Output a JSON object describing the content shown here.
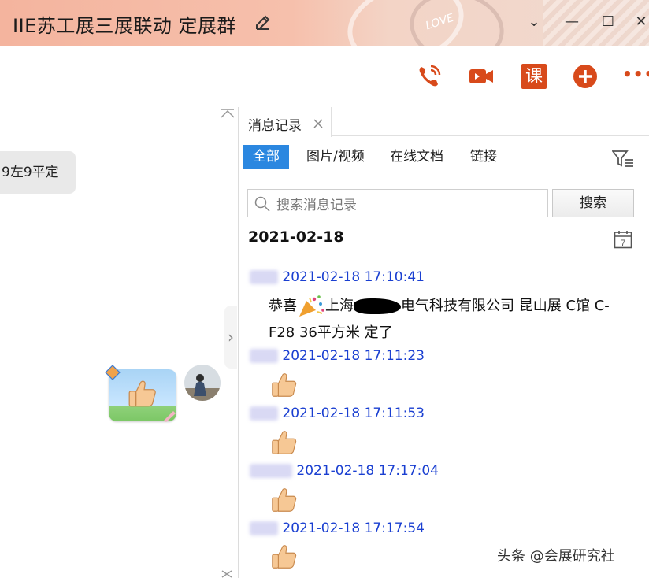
{
  "window": {
    "title": "IIE苏工展三展联动 定展群",
    "decor_text": "LOVE",
    "controls": {
      "menu": "⌄",
      "minimize": "—",
      "maximize": "☐",
      "close": "✕"
    }
  },
  "toolbar": {
    "icons": [
      "phone-icon",
      "video-call-icon",
      "class-icon",
      "add-icon",
      "more-icon"
    ],
    "class_label": "课",
    "more_label": "•••"
  },
  "chat": {
    "partial_message": "9左9平定",
    "collapse_arrow": "›"
  },
  "history": {
    "tab_label": "消息记录",
    "filters": [
      "全部",
      "图片/视频",
      "在线文档",
      "链接"
    ],
    "active_filter": 0,
    "search": {
      "placeholder": "搜索消息记录",
      "button": "搜索"
    },
    "date_header": "2021-02-18",
    "calendar_day": "7",
    "messages": [
      {
        "time": "2021-02-18 17:10:41",
        "body_line1": "恭喜",
        "body_line1b": "上海",
        "body_line1c": "电气科技有限公司  昆山展 C馆 C-",
        "body_line2": "F28  36平方米 定了"
      },
      {
        "time": "2021-02-18 17:11:23",
        "body": "thumbs-up-icon"
      },
      {
        "time": "2021-02-18 17:11:53",
        "body": "thumbs-up-icon"
      },
      {
        "time": "2021-02-18 17:17:04",
        "body": "thumbs-up-icon"
      },
      {
        "time": "2021-02-18 17:17:54",
        "body": "thumbs-up-icon"
      }
    ]
  },
  "watermark": "头条 @会展研究社",
  "colors": {
    "accent": "#2b87e0",
    "icon_red": "#d84a1b",
    "link_blue": "#1a3fd1"
  }
}
